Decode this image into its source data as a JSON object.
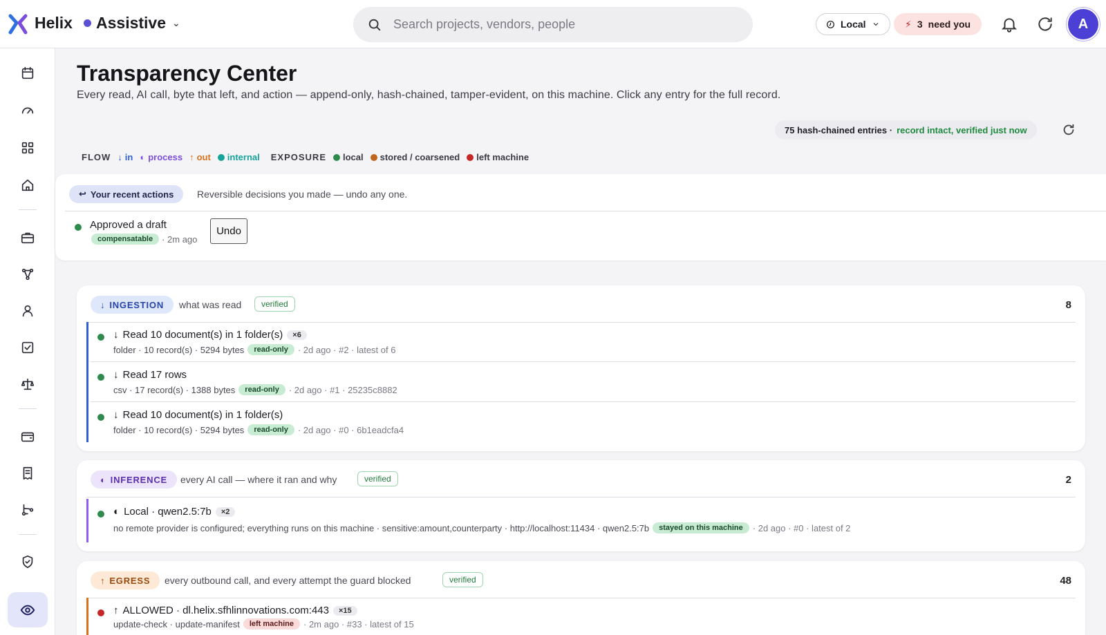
{
  "app": {
    "brand": "Helix",
    "mode": "Assistive"
  },
  "search": {
    "placeholder": "Search projects, vendors, people"
  },
  "header": {
    "local_label": "Local",
    "need_count": "3",
    "need_label": "need you",
    "avatar_initial": "A"
  },
  "page": {
    "title": "Transparency Center",
    "subtitle": "Every read, AI call, byte that left, and action — append-only, hash-chained, tamper-evident, on this machine. Click any entry for the full record.",
    "chain_count": "75 hash-chained entries ·",
    "chain_status": "record intact, verified just now"
  },
  "legend": {
    "flow_label": "FLOW",
    "in": "in",
    "process": "process",
    "out": "out",
    "internal": "internal",
    "exposure_label": "EXPOSURE",
    "local": "local",
    "stored": "stored / coarsened",
    "left": "left machine"
  },
  "recent": {
    "tag": "Your recent actions",
    "description": "Reversible decisions you made — undo any one.",
    "item_title": "Approved a draft",
    "item_chip": "compensatable",
    "item_time": "· 2m ago",
    "undo_label": "Undo"
  },
  "ingestion": {
    "tag": "INGESTION",
    "description": "what was read",
    "verified": "verified",
    "count": "8",
    "rows": [
      {
        "title": "Read 10 document(s) in 1 folder(s)",
        "badge": "×6",
        "meta": "folder · 10 record(s) · 5294 bytes",
        "chip": "read-only",
        "tail": "· 2d ago · #2 · latest of 6"
      },
      {
        "title": "Read 17 rows",
        "badge": "",
        "meta": "csv · 17 record(s) · 1388 bytes",
        "chip": "read-only",
        "tail": "· 2d ago · #1 · 25235c8882"
      },
      {
        "title": "Read 10 document(s) in 1 folder(s)",
        "badge": "",
        "meta": "folder · 10 record(s) · 5294 bytes",
        "chip": "read-only",
        "tail": "· 2d ago · #0 · 6b1eadcfa4"
      }
    ]
  },
  "inference": {
    "tag": "INFERENCE",
    "description": "every AI call — where it ran and why",
    "verified": "verified",
    "count": "2",
    "rows": [
      {
        "title": "Local · qwen2.5:7b",
        "badge": "×2",
        "meta": "no remote provider is configured; everything runs on this machine · sensitive:amount,counterparty · http://localhost:11434 · qwen2.5:7b",
        "chip": "stayed on this machine",
        "tail": "· 2d ago · #0 · latest of 2"
      }
    ]
  },
  "egress": {
    "tag": "EGRESS",
    "description": "every outbound call, and every attempt the guard blocked",
    "verified": "verified",
    "count": "48",
    "rows": [
      {
        "title": "ALLOWED · dl.helix.sfhlinnovations.com:443",
        "badge": "×15",
        "meta": "update-check · update-manifest",
        "chip": "left machine",
        "tail": "· 2m ago · #33 · latest of 15"
      }
    ]
  },
  "colors": {
    "accent": "#5b4fd6",
    "green": "#2e8b4d",
    "orange": "#d9701a",
    "red": "#c62828",
    "blue": "#2f5fd6",
    "purple": "#8b5cf6",
    "teal": "#14a39a"
  },
  "icons": [
    "logo-icon",
    "chevron-down-icon",
    "search-icon",
    "clock-icon",
    "bolt-icon",
    "bell-icon",
    "refresh-icon",
    "calendar-icon",
    "gauge-icon",
    "grid-icon",
    "home-icon",
    "briefcase-icon",
    "graph-icon",
    "person-icon",
    "checkbox-icon",
    "scale-icon",
    "wallet-icon",
    "receipt-icon",
    "route-icon",
    "shield-icon",
    "eye-icon"
  ]
}
